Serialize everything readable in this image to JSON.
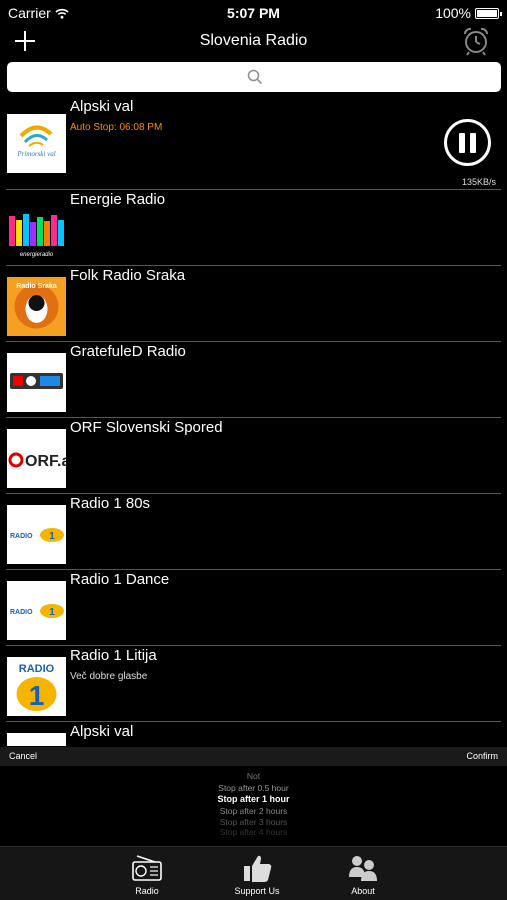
{
  "status_bar": {
    "carrier": "Carrier",
    "time": "5:07 PM",
    "battery": "100%"
  },
  "nav": {
    "title": "Slovenia Radio"
  },
  "stations": [
    {
      "name": "Alpski val",
      "sub": "Auto Stop: 06:08 PM",
      "rate": "135KB/s",
      "logo": "Primorski val"
    },
    {
      "name": "Energie Radio",
      "sub": "",
      "logo": "energieradio"
    },
    {
      "name": "Folk Radio Sraka",
      "sub": "",
      "logo": "Radio Sraka"
    },
    {
      "name": "GratefuleD Radio",
      "sub": "",
      "logo": ""
    },
    {
      "name": "ORF Slovenski Spored",
      "sub": "",
      "logo": "ORF.at"
    },
    {
      "name": "Radio 1 80s",
      "sub": "",
      "logo": "RADIO"
    },
    {
      "name": "Radio 1 Dance",
      "sub": "",
      "logo": "RADIO"
    },
    {
      "name": "Radio 1 Litija",
      "sub": "Več dobre glasbe",
      "logo": "RADIO"
    },
    {
      "name": "Alpski val",
      "sub": "",
      "logo": ""
    }
  ],
  "picker": {
    "cancel": "Cancel",
    "confirm": "Confirm",
    "options": [
      "Not",
      "Stop after 0.5 hour",
      "Stop after 1 hour",
      "Stop after 2 hours",
      "Stop after 3 hours",
      "Stop after 4 hours"
    ],
    "selected_index": 2
  },
  "tabs": [
    {
      "label": "Radio",
      "icon": "radio-icon"
    },
    {
      "label": "Support Us",
      "icon": "thumbs-up-icon"
    },
    {
      "label": "About",
      "icon": "about-icon"
    }
  ],
  "colors": {
    "accent": "#ff8c00",
    "background": "#000000",
    "search_bg": "#ffffff"
  }
}
